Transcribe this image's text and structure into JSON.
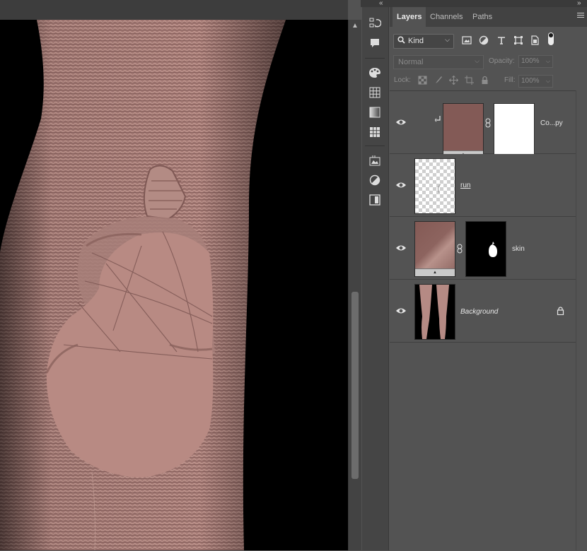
{
  "colors": {
    "ui_dark": "#3d3d3d",
    "panel_bg": "#535353",
    "canvas_bg": "#000000",
    "skin_tone": "#b88a83",
    "fill_color": "#835a56"
  },
  "dock": {
    "collapse_left": "«",
    "collapse_right": "»"
  },
  "toolbar": {
    "icons": [
      "history-icon",
      "comments-icon",
      "color-palette-icon",
      "swatches-grid-icon",
      "gradient-icon",
      "patterns-icon",
      "libraries-icon",
      "adjustments-icon",
      "properties-icon"
    ]
  },
  "layers_panel": {
    "tabs": [
      {
        "label": "Layers",
        "active": true
      },
      {
        "label": "Channels",
        "active": false
      },
      {
        "label": "Paths",
        "active": false
      }
    ],
    "filter": {
      "kind_label": "Kind",
      "icons": [
        "pixel-filter-icon",
        "adjustment-filter-icon",
        "type-filter-icon",
        "shape-filter-icon",
        "smart-object-filter-icon"
      ]
    },
    "blend_mode": "Normal",
    "opacity_label": "Opacity:",
    "opacity_value": "100%",
    "lock_label": "Lock:",
    "fill_label": "Fill:",
    "fill_value": "100%",
    "layers": [
      {
        "name": "Co...py",
        "type": "fill",
        "clipped": true,
        "has_mask": true,
        "visible": true,
        "locked": false
      },
      {
        "name": "run",
        "type": "pixel",
        "clipped": false,
        "has_mask": false,
        "visible": true,
        "locked": false
      },
      {
        "name": "skin",
        "type": "fill",
        "clipped": false,
        "has_mask": true,
        "visible": true,
        "locked": false
      },
      {
        "name": "Background",
        "type": "pixel",
        "clipped": false,
        "has_mask": false,
        "visible": true,
        "locked": true
      }
    ]
  }
}
